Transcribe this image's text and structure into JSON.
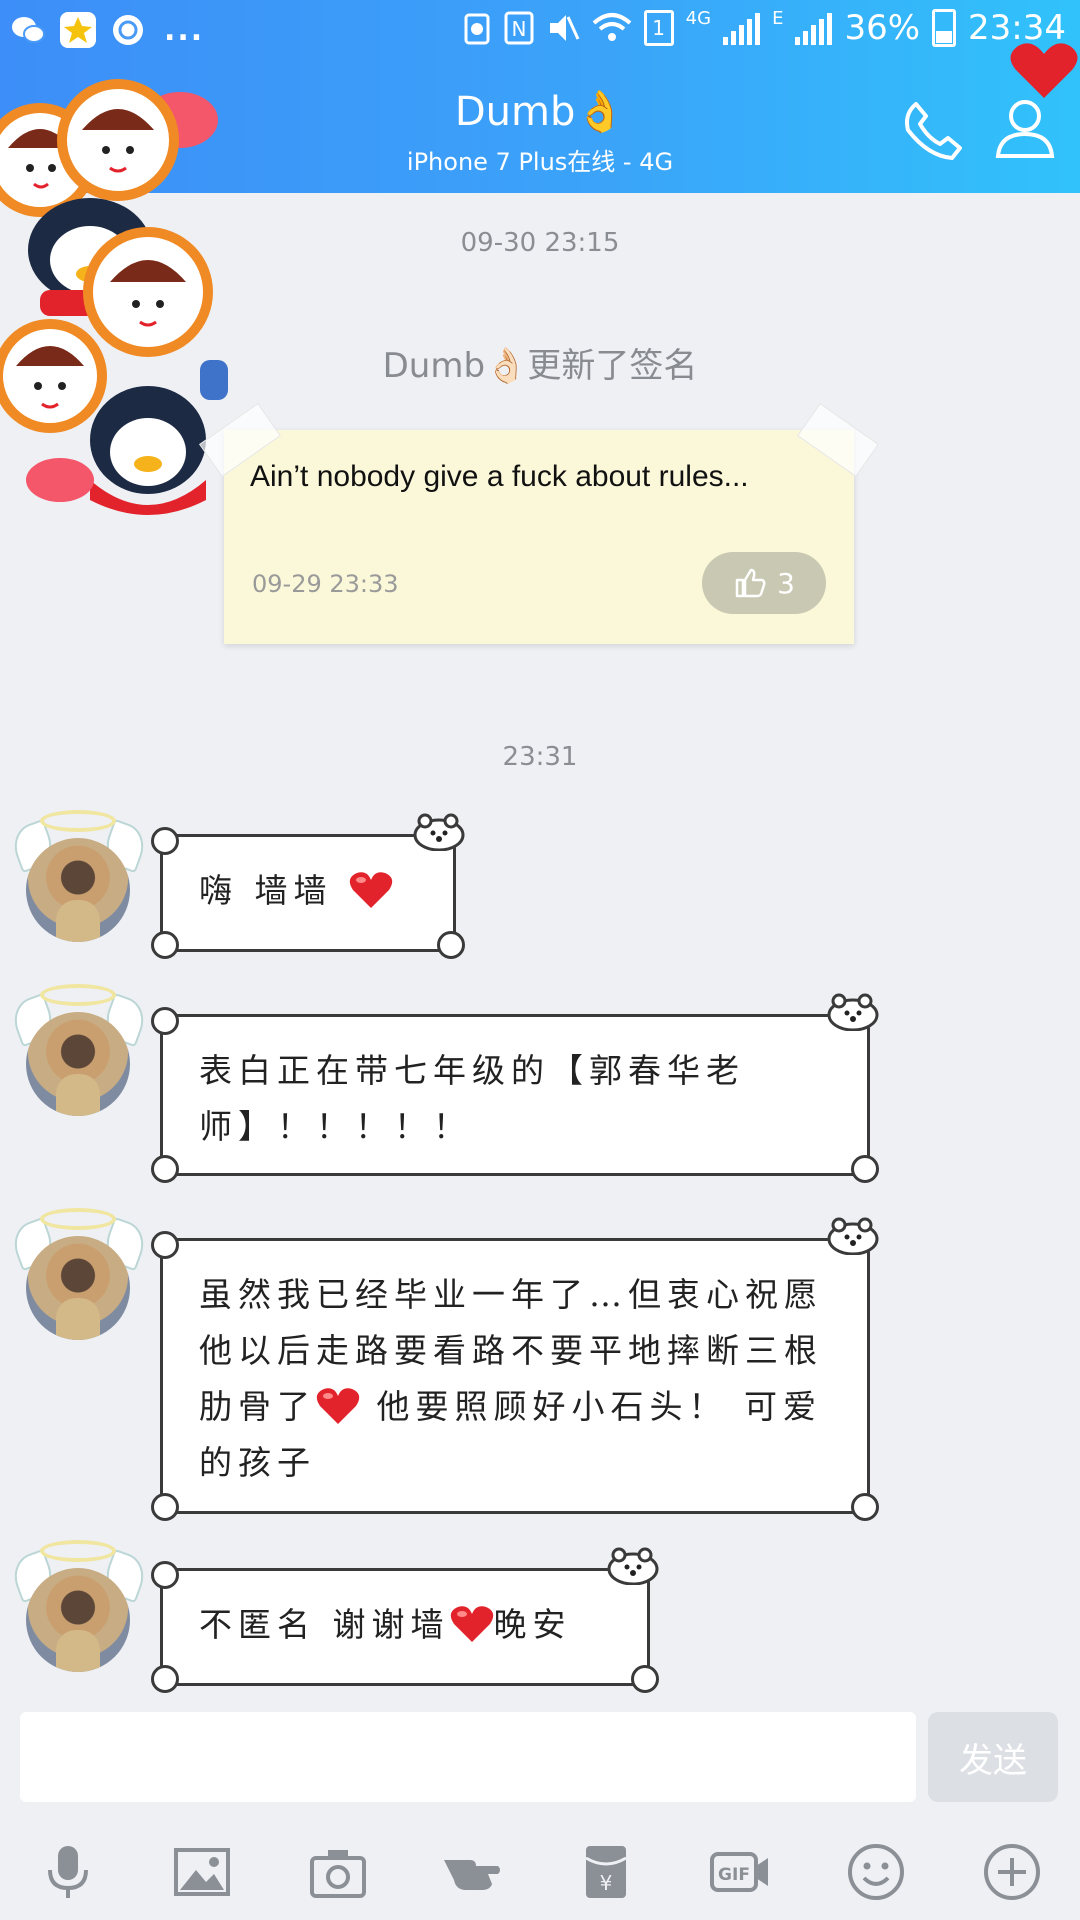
{
  "status_bar": {
    "left_icons": [
      "wechat-icon",
      "qzone-star-icon",
      "qq-icon"
    ],
    "more": "...",
    "network": "4G",
    "edge": "E",
    "sim_slot": "1",
    "battery_percent": "36%",
    "battery_level": 0.36,
    "time": "23:34"
  },
  "header": {
    "title": "Dumb👌",
    "subtitle": "iPhone 7 Plus在线 - 4G"
  },
  "chat": {
    "timestamp_1": "09-30 23:15",
    "system_message": "Dumb👌🏻更新了签名",
    "signature_card": {
      "text": "Ain’t nobody give a fuck about rules...",
      "date": "09-29 23:33",
      "likes": "3"
    },
    "timestamp_2": "23:31",
    "messages": [
      {
        "part1": "嗨 墙墙 ",
        "part2": ""
      },
      {
        "text": "表白正在带七年级的【郭春华老师】！！！！！"
      },
      {
        "part1": "虽然我已经毕业一年了…但衷心祝愿他以后走路要看路不要平地摔断三根肋骨了",
        "part2": " 他要照顾好小石头！ 可爱的孩子"
      },
      {
        "part1": "不匿名 谢谢墙",
        "part2": "晚安"
      }
    ]
  },
  "input": {
    "value": "",
    "send_label": "发送"
  },
  "toolbar_icons": [
    "microphone-icon",
    "image-icon",
    "camera-icon",
    "poke-hand-icon",
    "red-packet-icon",
    "gif-icon",
    "emoji-icon",
    "plus-icon"
  ],
  "colors": {
    "header_start": "#3d8ef8",
    "header_end": "#31c2fb",
    "background": "#eef0f4",
    "signature_card": "#fbf8d9",
    "heart": "#e3232b"
  }
}
